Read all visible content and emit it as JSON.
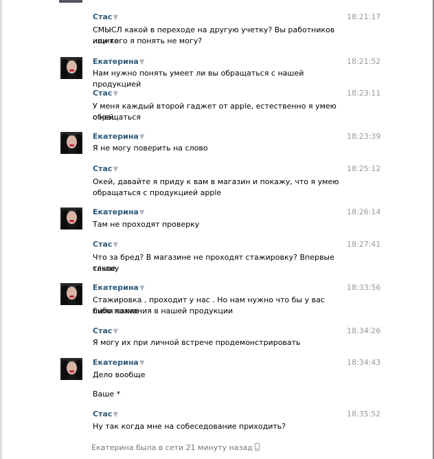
{
  "messages": [
    {
      "author": "Стас",
      "time": "18:21:17",
      "avatar": false,
      "lines": [
        "СМЫСЛ какой в переходе на другую учетку? Вы работников ищите",
        "или кого я понять не могу?"
      ]
    },
    {
      "author": "Екатерина",
      "time": "18:21:52",
      "avatar": true,
      "lines": [
        "Нам нужно понять умеет ли вы обращаться с нашей продукцией"
      ]
    },
    {
      "author": "Стас",
      "time": "18:23:11",
      "avatar": false,
      "lines": [
        "У меня каждый второй гаджет от apple, естественно я умею с ней",
        "обращаться"
      ]
    },
    {
      "author": "Екатерина",
      "time": "18:23:39",
      "avatar": true,
      "lines": [
        "Я не могу поверить на слово"
      ]
    },
    {
      "author": "Стас",
      "time": "18:25:12",
      "avatar": false,
      "lines": [
        "Окей, давайте я приду к вам в магазин и покажу, что я умею",
        "обращаться с продукцией apple"
      ]
    },
    {
      "author": "Екатерина",
      "time": "18:26:14",
      "avatar": true,
      "lines": [
        "Там не проходят проверку"
      ]
    },
    {
      "author": "Стас",
      "time": "18:27:41",
      "avatar": false,
      "lines": [
        "Что за бред? В магазине не проходят стажировку? Впервые такое",
        "слышу"
      ]
    },
    {
      "author": "Екатерина",
      "time": "18:33:56",
      "avatar": true,
      "lines": [
        "Стажировка , проходит у нас . Но нам нужно что бы у вас были какие",
        "либо познания в нашей продукции"
      ]
    },
    {
      "author": "Стас",
      "time": "18:34:26",
      "avatar": false,
      "lines": [
        "Я могу их при личной встрече продемонстрировать"
      ]
    },
    {
      "author": "Екатерина",
      "time": "18:34:43",
      "avatar": true,
      "lines": [
        "Дело вообще",
        "Ваше *"
      ]
    },
    {
      "author": "Стас",
      "time": "18:35:52",
      "avatar": false,
      "lines": [
        "Ну так когда мне на собеседование приходить?"
      ]
    }
  ],
  "footer": {
    "status_text": "Екатерина была в сети 21 минуту назад",
    "icon": "phone-icon"
  },
  "colors": {
    "author": "#2b587a",
    "time": "#999999",
    "footer": "#777777"
  }
}
